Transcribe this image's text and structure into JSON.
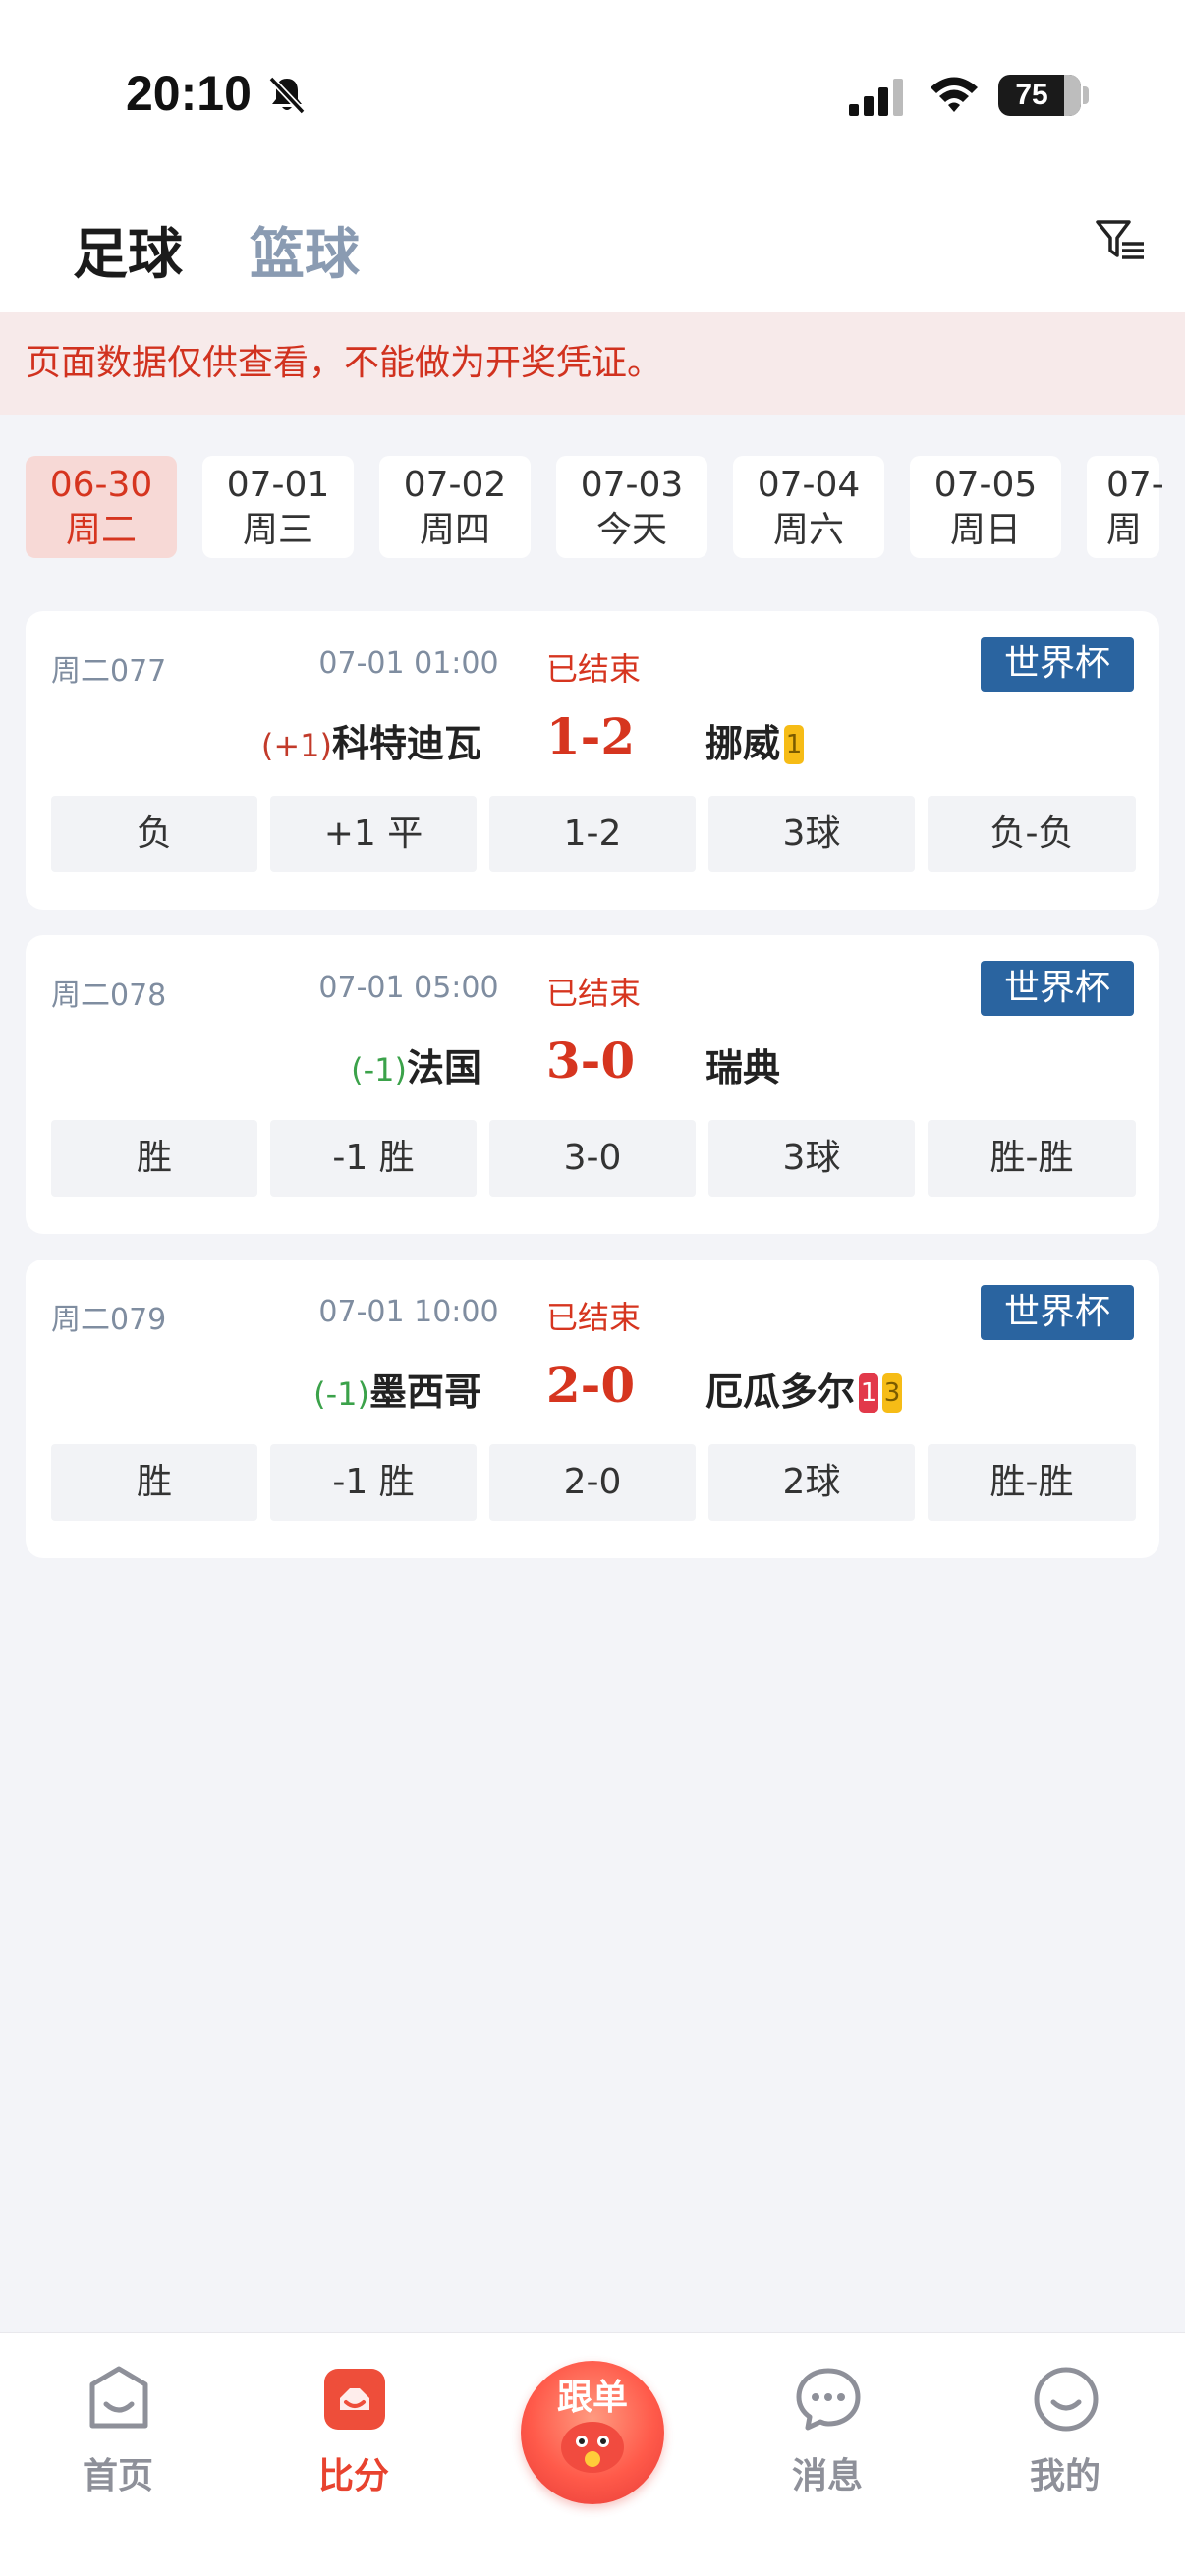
{
  "status_bar": {
    "time": "20:10",
    "battery": "75"
  },
  "sport_tabs": [
    {
      "label": "足球",
      "active": true
    },
    {
      "label": "篮球",
      "active": false
    }
  ],
  "notice": "页面数据仅供查看，不能做为开奖凭证。",
  "dates": [
    {
      "date": "06-30",
      "day": "周二",
      "active": true
    },
    {
      "date": "07-01",
      "day": "周三",
      "active": false
    },
    {
      "date": "07-02",
      "day": "周四",
      "active": false
    },
    {
      "date": "07-03",
      "day": "今天",
      "active": false
    },
    {
      "date": "07-04",
      "day": "周六",
      "active": false
    },
    {
      "date": "07-05",
      "day": "周日",
      "active": false
    },
    {
      "date": "07-",
      "day": "周",
      "active": false
    }
  ],
  "matches": [
    {
      "code": "周二077",
      "time": "07-01 01:00",
      "status": "已结束",
      "league": "世界杯",
      "home_handicap": "(+1)",
      "home": "科特迪瓦",
      "score": "1-2",
      "away": "挪威",
      "away_badges": [
        {
          "color": "yellow",
          "text": "1"
        }
      ],
      "results": [
        "负",
        "+1 平",
        "1-2",
        "3球",
        "负-负"
      ]
    },
    {
      "code": "周二078",
      "time": "07-01 05:00",
      "status": "已结束",
      "league": "世界杯",
      "home_handicap": "(-1)",
      "home": "法国",
      "score": "3-0",
      "away": "瑞典",
      "away_badges": [],
      "results": [
        "胜",
        "-1 胜",
        "3-0",
        "3球",
        "胜-胜"
      ]
    },
    {
      "code": "周二079",
      "time": "07-01 10:00",
      "status": "已结束",
      "league": "世界杯",
      "home_handicap": "(-1)",
      "home": "墨西哥",
      "score": "2-0",
      "away": "厄瓜多尔",
      "away_badges": [
        {
          "color": "red",
          "text": "1"
        },
        {
          "color": "yellow",
          "text": "3"
        }
      ],
      "results": [
        "胜",
        "-1 胜",
        "2-0",
        "2球",
        "胜-胜"
      ]
    }
  ],
  "bottom_nav": [
    {
      "label": "首页",
      "icon": "home-icon",
      "active": false
    },
    {
      "label": "比分",
      "icon": "score-icon",
      "active": true
    },
    {
      "label": "跟单",
      "icon": "follow-mascot-icon",
      "active": false
    },
    {
      "label": "消息",
      "icon": "message-icon",
      "active": false
    },
    {
      "label": "我的",
      "icon": "profile-icon",
      "active": false
    }
  ],
  "colors": {
    "accent": "#d6351f",
    "league_badge": "#2a64a0",
    "handicap_plus": "#c23a2a",
    "handicap_minus": "#3ba24a"
  }
}
